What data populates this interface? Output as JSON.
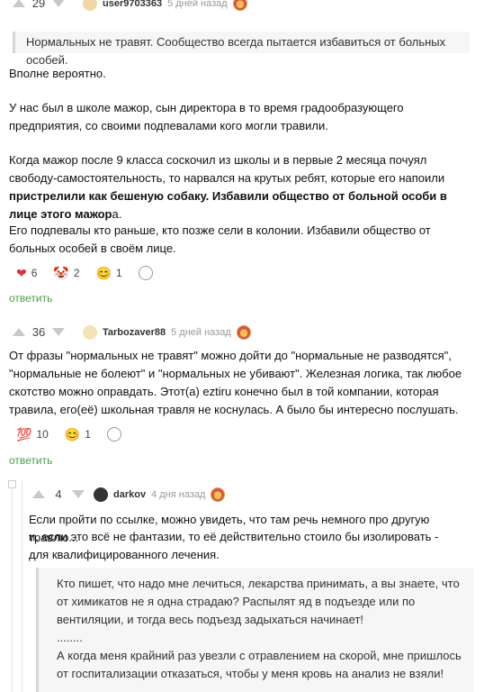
{
  "comment1": {
    "vote_count": "29",
    "username": "user9703363",
    "time": "5 дней назад",
    "quote": "Нормальных не травят. Сообщество всегда пытается избавиться от больных особей.",
    "paragraphs": [
      "Вполне вероятно.",
      "У нас был в школе мажор, сын директора в то время градообразующего предприятия, со своими подпевалами кого могли травили.",
      "Его подпевалы кто раньше, кто позже сели в колонии. Избавили общество от больных особей в своём лице."
    ],
    "p3_part1": "Когда мажор после 9 класса соскочил из школы и в первые 2 месяца почуял свободу-самостоятельность, то нарвался на крутых ребят, которые его напоили ",
    "p3_bold": "пристрелили как бешеную собаку. Избавили общество от больной особи в лице этого мажор",
    "p3_end": "а.",
    "reactions": [
      {
        "emoji": "❤",
        "count": "6",
        "icon": "heart-icon"
      },
      {
        "emoji": "🤡",
        "count": "2",
        "icon": "clown-icon"
      },
      {
        "emoji": "😊",
        "count": "1",
        "icon": "smile-icon"
      }
    ],
    "reply_label": "ответить"
  },
  "comment2": {
    "vote_count": "36",
    "username": "Tarbozaver88",
    "time": "5 дней назад",
    "text": "От фразы \"нормальных не травят\" можно дойти до \"нормальные не разводятся\", \"нормальные не болеют\" и \"нормальных не убивают\". Железная логика, так любое скотство можно оправдать. Этот(а) eztiru конечно был в той компании, которая травила, его(её) школьная травля не коснулась. А было бы интересно послушать.",
    "reactions": [
      {
        "emoji": "💯",
        "count": "10",
        "icon": "hundred-icon"
      },
      {
        "emoji": "😊",
        "count": "1",
        "icon": "smile-icon"
      }
    ],
    "reply_label": "ответить"
  },
  "comment3": {
    "vote_count": "4",
    "username": "darkov",
    "time": "4 дня назад",
    "lines": [
      "Если пройти по ссылке, можно увидеть, что там речь немного про другую травлю...",
      "и, если это всё не фантазии, то её действительно стоило бы изолировать - для квалифицированного лечения."
    ],
    "quote1": "Кто пишет, что надо мне лечиться, лекарства принимать, а вы знаете, что от химикатов не я одна страдаю? Распылят яд в подъезде или по вентиляции, и тогда весь подъезд задыхаться начинает!",
    "quote_dots": "........",
    "quote2": "А когда меня крайний раз увезли с отравлением на скорой, мне пришлось от госпитализации отказаться, чтобы у меня кровь на анализ не взяли!"
  }
}
